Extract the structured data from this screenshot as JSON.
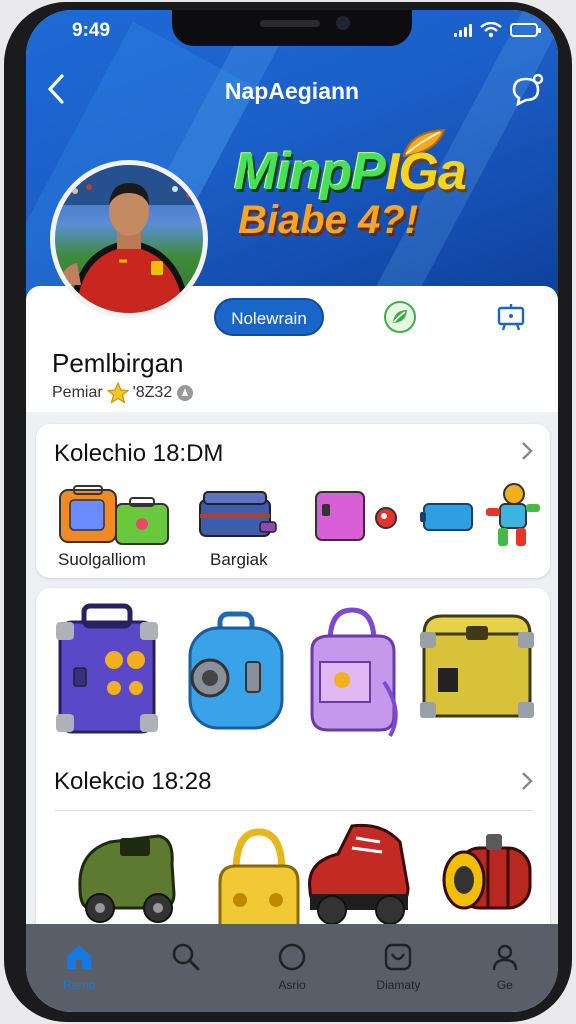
{
  "status_bar": {
    "time": "9:49"
  },
  "header": {
    "title": "NapAegiann"
  },
  "banner": {
    "line1_green": "MinpP",
    "line1_yellow": "IGa",
    "line2": "Biabe 4?!"
  },
  "profile": {
    "tab_label": "Nolewrain",
    "name": "Pemlbirgan",
    "subtitle_prefix": "Pemiar",
    "subtitle_value": "'8Z32"
  },
  "collection1": {
    "title": "Kolechio 18:DM",
    "items": [
      {
        "label": "Suolgalliom"
      },
      {
        "label": "Bargiak"
      }
    ]
  },
  "collection2": {
    "title": "Kolekcio 18:28"
  },
  "bottom_nav": {
    "items": [
      {
        "label": "Remo",
        "icon": "home-icon"
      },
      {
        "label": "",
        "icon": "search-icon"
      },
      {
        "label": "Asrio",
        "icon": "circle-icon"
      },
      {
        "label": "Diamaty",
        "icon": "shop-icon"
      },
      {
        "label": "Ge",
        "icon": "profile-icon"
      }
    ]
  },
  "colors": {
    "accent": "#1a66c8",
    "hero": "#1f6ad6",
    "nav_bg": "#5a5e68",
    "active_nav": "#1778e0"
  }
}
